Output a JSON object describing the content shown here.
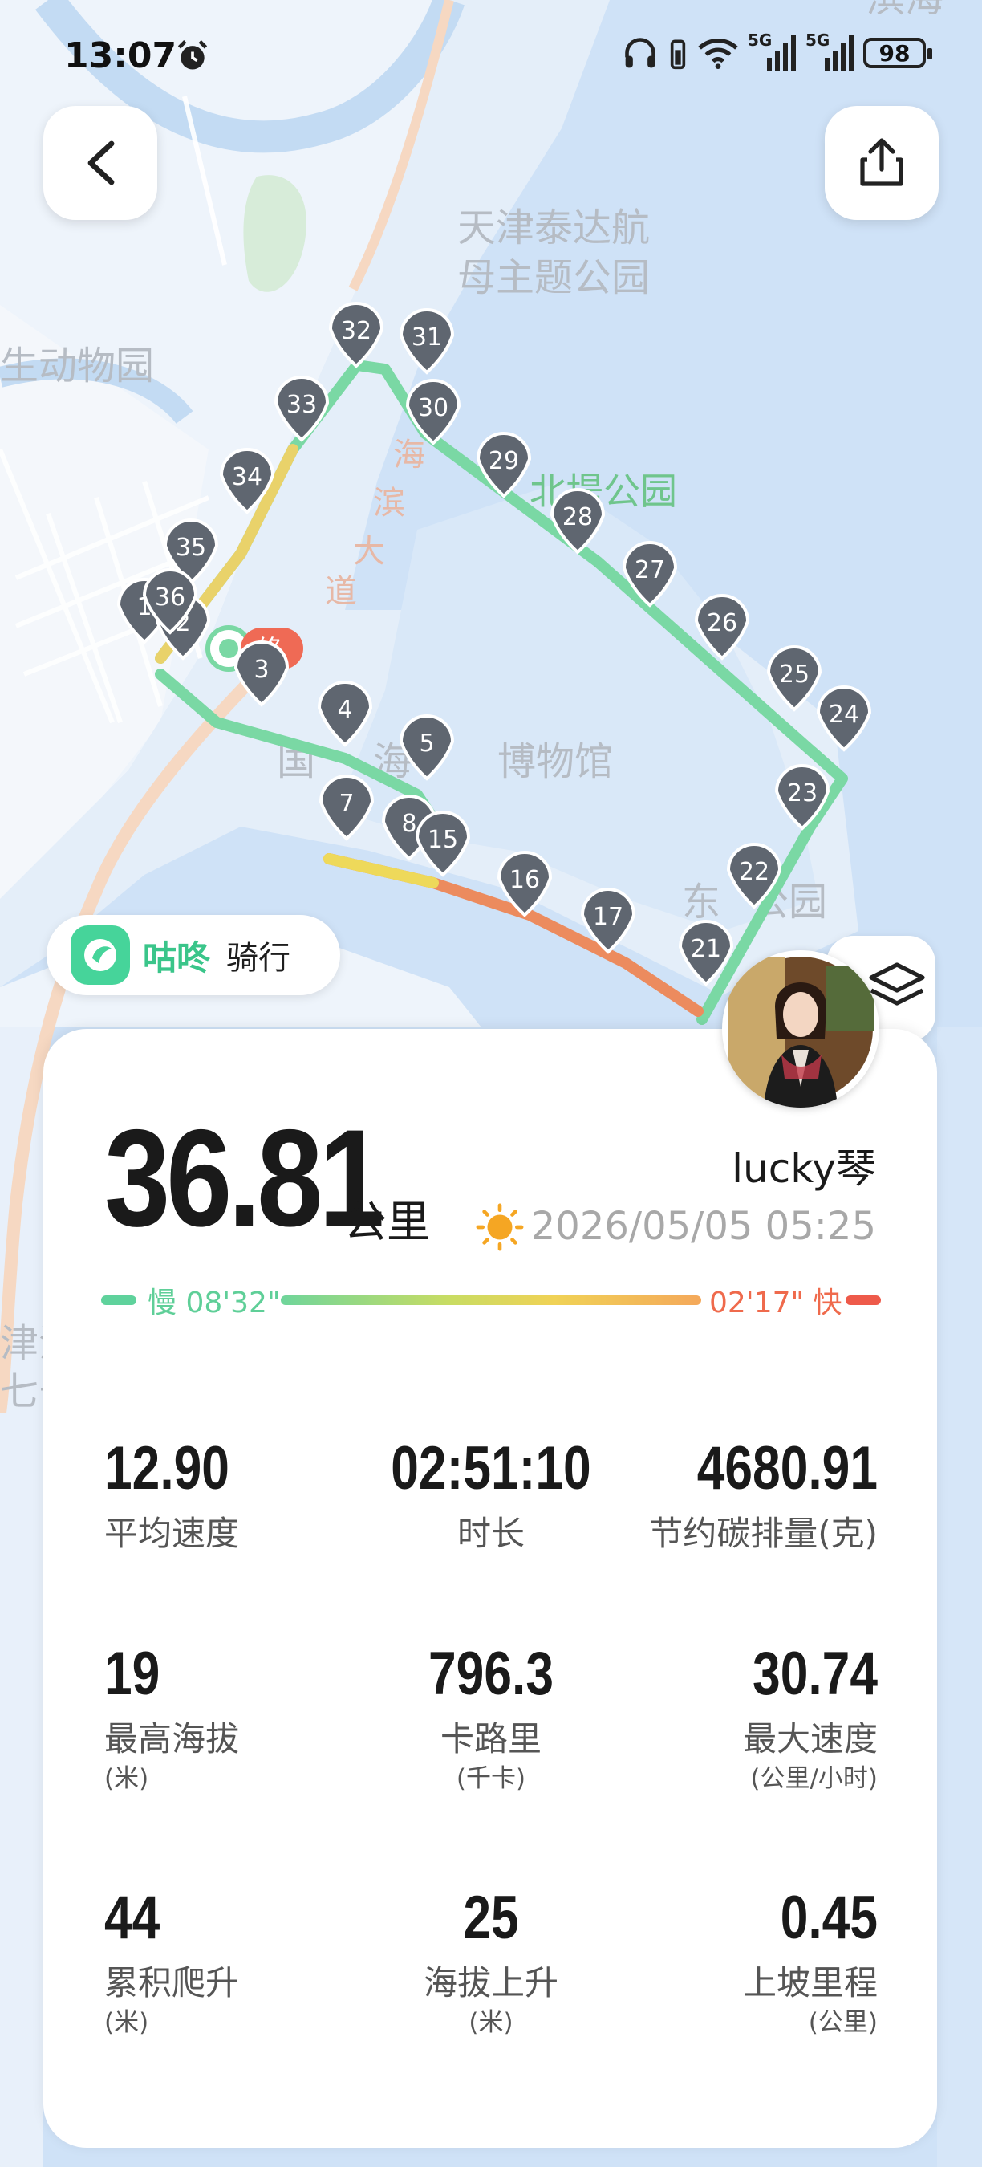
{
  "status_bar": {
    "time": "13:07",
    "battery": "98",
    "net_labels": [
      "5G",
      "5G"
    ]
  },
  "map": {
    "place_labels": [
      "天津泰达航",
      "母主题公园",
      "生动物园",
      "北堤公园",
      "海",
      "滨",
      "大",
      "道",
      "国",
      "海",
      "博物馆",
      "东",
      "公园",
      "津海",
      "七号",
      "滨海"
    ],
    "markers": [
      "1",
      "2",
      "3",
      "4",
      "5",
      "7",
      "8",
      "15",
      "16",
      "17",
      "21",
      "22",
      "23",
      "24",
      "25",
      "26",
      "27",
      "28",
      "29",
      "30",
      "31",
      "32",
      "33",
      "34",
      "35",
      "36"
    ],
    "end_label": "终",
    "route_colors": {
      "slow": "#6fd59b",
      "mid": "#f0d256",
      "fast": "#ee6a4c"
    }
  },
  "brand": {
    "name": "咕咚",
    "mode": "骑行"
  },
  "summary": {
    "distance": "36.81",
    "distance_unit": "公里",
    "username": "lucky琴",
    "datetime": "2026/05/05 05:25",
    "weather_icon": "sun-icon",
    "pace_slow": "慢 08'32\"",
    "pace_fast": "02'17\" 快"
  },
  "stats": [
    {
      "value": "12.90",
      "label": "平均速度",
      "unit": ""
    },
    {
      "value": "02:51:10",
      "label": "时长",
      "unit": ""
    },
    {
      "value": "4680.91",
      "label": "节约碳排量(克)",
      "unit": ""
    },
    {
      "value": "19",
      "label": "最高海拔",
      "unit": "(米)"
    },
    {
      "value": "796.3",
      "label": "卡路里",
      "unit": "(千卡)"
    },
    {
      "value": "30.74",
      "label": "最大速度",
      "unit": "(公里/小时)"
    },
    {
      "value": "44",
      "label": "累积爬升",
      "unit": "(米)"
    },
    {
      "value": "25",
      "label": "海拔上升",
      "unit": "(米)"
    },
    {
      "value": "0.45",
      "label": "上坡里程",
      "unit": "(公里)"
    }
  ]
}
